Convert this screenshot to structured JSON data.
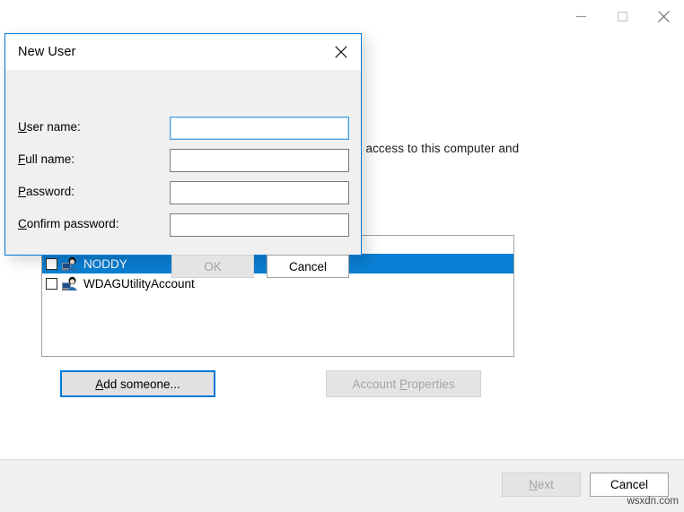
{
  "host_window": {
    "caption_buttons": [
      {
        "name": "minimize",
        "glyph": "minimize-icon"
      },
      {
        "name": "maximize",
        "glyph": "maximize-icon"
      },
      {
        "name": "close",
        "glyph": "close-icon"
      }
    ],
    "description_partial": "n access to this computer and",
    "user_list": {
      "items": [
        {
          "label": "",
          "icon": "user-account-icon",
          "selected": false,
          "checked": false,
          "occluded": true
        },
        {
          "label": "NODDY",
          "icon": "user-account-icon",
          "selected": true,
          "checked": false,
          "occluded": false
        },
        {
          "label": "WDAGUtilityAccount",
          "icon": "user-account-icon",
          "selected": false,
          "checked": false,
          "occluded": false
        }
      ]
    },
    "add_someone_button": {
      "label": "Add someone...",
      "accel": "A",
      "enabled": true,
      "focused": true
    },
    "account_properties_button": {
      "label": "Account Properties",
      "accel": "P",
      "enabled": false,
      "focused": false
    },
    "next_button": {
      "label": "Next",
      "accel": "N",
      "enabled": false
    },
    "cancel_button": {
      "label": "Cancel",
      "accel": "",
      "enabled": true
    },
    "watermark": "wsxdn.com"
  },
  "new_user_dialog": {
    "title": "New User",
    "close_icon": "close-icon",
    "fields": [
      {
        "label_before": "",
        "accel": "U",
        "label_after": "ser name:",
        "value": "",
        "placeholder": "",
        "focused": true,
        "masked": false
      },
      {
        "label_before": "",
        "accel": "F",
        "label_after": "ull name:",
        "value": "",
        "placeholder": "",
        "focused": false,
        "masked": false
      },
      {
        "label_before": "",
        "accel": "P",
        "label_after": "assword:",
        "value": "",
        "placeholder": "",
        "focused": false,
        "masked": true
      },
      {
        "label_before": "",
        "accel": "C",
        "label_after": "onfirm password:",
        "value": "",
        "placeholder": "",
        "focused": false,
        "masked": true
      }
    ],
    "ok_button": {
      "label": "OK",
      "enabled": false
    },
    "cancel_button": {
      "label": "Cancel",
      "enabled": true
    }
  },
  "colors": {
    "accent": "#0078d7",
    "selection": "#0a7fd4",
    "dialog_body": "#f0f0f0",
    "button_face": "#e1e1e1",
    "disabled_text": "#a4a4a4"
  }
}
